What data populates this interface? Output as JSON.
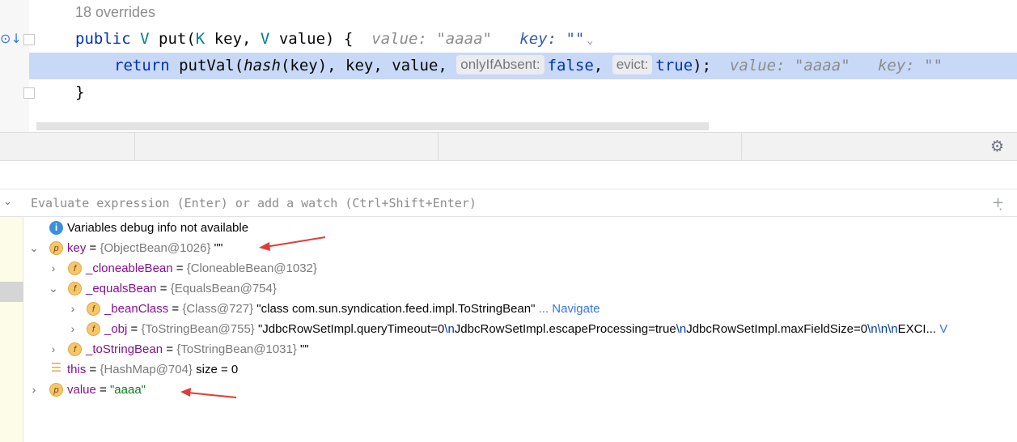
{
  "editor": {
    "overrides_label": "18 overrides",
    "signature": {
      "modifier": "public",
      "generic_v": "V",
      "method": "put",
      "param_type_k": "K",
      "param_key": "key,",
      "param_type_v": "V",
      "param_value": "value)",
      "brace": "{",
      "hint_value": "value: \"aaaa\"",
      "hint_key": "key: \"\"",
      "hint_chevron": "⌄"
    },
    "return_line": {
      "keyword": "return",
      "call": "putVal(",
      "hash_call": "hash",
      "hash_args": "(key), key, value,",
      "hint_only_if_absent": "onlyIfAbsent:",
      "value_false": "false",
      "comma": ",",
      "hint_evict": "evict:",
      "value_true": "true",
      "close": ");",
      "inline_value": "value: \"aaaa\"",
      "inline_key": "key: \"\""
    },
    "closing_brace": "}",
    "exec_marker_icon": "execution-point-icon"
  },
  "toolbar": {
    "settings_icon": "gear-icon"
  },
  "evaluate": {
    "placeholder": "Evaluate expression (Enter) or add a watch (Ctrl+Shift+Enter)",
    "add_icon": "add-watch-icon"
  },
  "variables": {
    "info": "Variables debug info not available",
    "key": {
      "name": "key",
      "eq": "=",
      "ref": "{ObjectBean@1026}",
      "val": "\"\""
    },
    "cloneable": {
      "name": "_cloneableBean",
      "eq": "=",
      "ref": "{CloneableBean@1032}"
    },
    "equals": {
      "name": "_equalsBean",
      "eq": "=",
      "ref": "{EqualsBean@754}"
    },
    "bean_class": {
      "name": "_beanClass",
      "eq": "=",
      "ref": "{Class@727}",
      "val": "\"class com.sun.syndication.feed.impl.ToStringBean\"",
      "nav": "... Navigate"
    },
    "obj": {
      "name": "_obj",
      "eq": "=",
      "ref": "{ToStringBean@755}",
      "val_parts": [
        "\"JdbcRowSetImpl.queryTimeout=0",
        "\\n",
        "JdbcRowSetImpl.escapeProcessing=true",
        "\\n",
        "JdbcRowSetImpl.maxFieldSize=0",
        "\\n\\n\\n",
        "EXCI...",
        " V"
      ]
    },
    "to_string": {
      "name": "_toStringBean",
      "eq": "=",
      "ref": "{ToStringBean@1031}",
      "val": "\"\""
    },
    "this": {
      "name": "this",
      "eq": "=",
      "ref": "{HashMap@704}",
      "val": "size = 0"
    },
    "value": {
      "name": "value",
      "eq": "=",
      "val": "\"aaaa\""
    }
  },
  "annotations": {
    "arrow_color": "#e53935"
  }
}
